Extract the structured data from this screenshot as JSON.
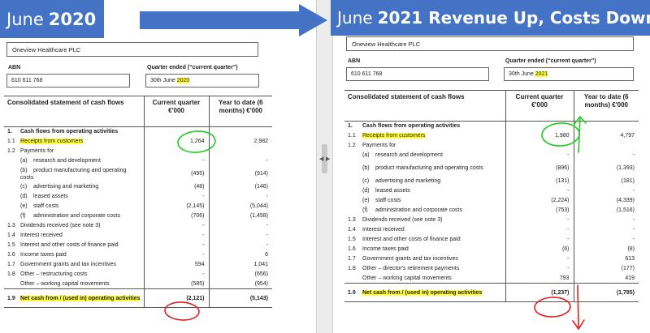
{
  "banners": {
    "left": {
      "prefix": "June",
      "bold": "2020"
    },
    "right": {
      "prefix": "June",
      "bold": "2021 Revenue Up, Costs Down"
    }
  },
  "colors": {
    "banner_blue": "#4472c4",
    "highlight": "#ffff33",
    "annotation_green": "#22cc22",
    "annotation_red": "#e02020"
  },
  "header_labels": {
    "abn_label": "ABN",
    "quarter_label": "Quarter ended (“current quarter”)",
    "table_title": "Consolidated statement of cash flows",
    "current_quarter_header": "Current quarter €'000",
    "ytd_header": "Year to date (6 months) €'000"
  },
  "reports": [
    {
      "company": "Oneview Healthcare PLC",
      "abn": "610 611 768",
      "quarter_prefix": "30th June ",
      "quarter_year": "2020",
      "rows": [
        {
          "ref": "1.",
          "label": "Cash flows from operating activities",
          "cur": "",
          "ytd": ""
        },
        {
          "ref": "1.1",
          "label": "Receipts from customers",
          "cur": "1,264",
          "ytd": "2,982"
        },
        {
          "ref": "1.2",
          "label": "Payments for",
          "cur": "",
          "ytd": ""
        },
        {
          "ref": "",
          "sub": "(a)",
          "label": "research and development",
          "cur": "-",
          "ytd": "-"
        },
        {
          "ref": "",
          "sub": "(b)",
          "label": "product manufacturing and operating costs",
          "cur": "(495)",
          "ytd": "(914)"
        },
        {
          "ref": "",
          "sub": "(c)",
          "label": "advertising and marketing",
          "cur": "(48)",
          "ytd": "(146)"
        },
        {
          "ref": "",
          "sub": "(d)",
          "label": "leased assets",
          "cur": "-",
          "ytd": "-"
        },
        {
          "ref": "",
          "sub": "(e)",
          "label": "staff costs",
          "cur": "(2,145)",
          "ytd": "(5,044)"
        },
        {
          "ref": "",
          "sub": "(f)",
          "label": "administration and corporate costs",
          "cur": "(706)",
          "ytd": "(1,458)"
        },
        {
          "ref": "1.3",
          "label": "Dividends received (see note 3)",
          "cur": "-",
          "ytd": "-"
        },
        {
          "ref": "1.4",
          "label": "Interest received",
          "cur": "-",
          "ytd": "-"
        },
        {
          "ref": "1.5",
          "label": "Interest and other costs of finance paid",
          "cur": "-",
          "ytd": "-"
        },
        {
          "ref": "1.6",
          "label": "Income taxes paid",
          "cur": "-",
          "ytd": "6"
        },
        {
          "ref": "1.7",
          "label": "Government grants and tax incentives",
          "cur": "594",
          "ytd": "1,041"
        },
        {
          "ref": "1.8",
          "label": "Other – restructuring costs",
          "cur": "-",
          "ytd": "(656)"
        },
        {
          "ref": "",
          "label": "Other – working capital movements",
          "cur": "(585)",
          "ytd": "(954)"
        }
      ],
      "total": {
        "ref": "1.9",
        "label": "Net cash from / (used in) operating activities",
        "cur": "(2,121)",
        "ytd": "(5,143)"
      }
    },
    {
      "company": "Oneview Healthcare PLC",
      "abn": "610 611 768",
      "quarter_prefix": "30th June ",
      "quarter_year": "2021",
      "rows": [
        {
          "ref": "1.",
          "label": "Cash flows from operating activities",
          "cur": "",
          "ytd": ""
        },
        {
          "ref": "1.1",
          "label": "Receipts from customers",
          "cur": "1,980",
          "ytd": "4,797"
        },
        {
          "ref": "1.2",
          "label": "Payments for",
          "cur": "",
          "ytd": ""
        },
        {
          "ref": "",
          "sub": "(a)",
          "label": "research and development",
          "cur": "-",
          "ytd": "-"
        },
        {
          "ref": "",
          "sub": "(b)",
          "label": "product manufacturing and operating costs",
          "cur": "(896)",
          "ytd": "(1,393)"
        },
        {
          "ref": "",
          "sub": "(c)",
          "label": "advertising and marketing",
          "cur": "(131)",
          "ytd": "(181)"
        },
        {
          "ref": "",
          "sub": "(d)",
          "label": "leased assets",
          "cur": "-",
          "ytd": "-"
        },
        {
          "ref": "",
          "sub": "(e)",
          "label": "staff costs",
          "cur": "(2,224)",
          "ytd": "(4,339)"
        },
        {
          "ref": "",
          "sub": "(f)",
          "label": "administration and corporate costs",
          "cur": "(753)",
          "ytd": "(1,516)"
        },
        {
          "ref": "1.3",
          "label": "Dividends received (see note 3)",
          "cur": "-",
          "ytd": "-"
        },
        {
          "ref": "1.4",
          "label": "Interest received",
          "cur": "-",
          "ytd": "-"
        },
        {
          "ref": "1.5",
          "label": "Interest and other costs of finance paid",
          "cur": "-",
          "ytd": "-"
        },
        {
          "ref": "1.6",
          "label": "Income taxes paid",
          "cur": "(6)",
          "ytd": "(8)"
        },
        {
          "ref": "1.7",
          "label": "Government grants and tax incentives",
          "cur": "-",
          "ytd": "613"
        },
        {
          "ref": "1.8",
          "label": "Other – director's retirement payments",
          "cur": "-",
          "ytd": "(177)"
        },
        {
          "ref": "",
          "label": "Other – working capital movements",
          "cur": "793",
          "ytd": "419"
        }
      ],
      "total": {
        "ref": "1.9",
        "label": "Net cash from / (used in) operating activities",
        "cur": "(1,237)",
        "ytd": "(1,785)"
      }
    }
  ]
}
